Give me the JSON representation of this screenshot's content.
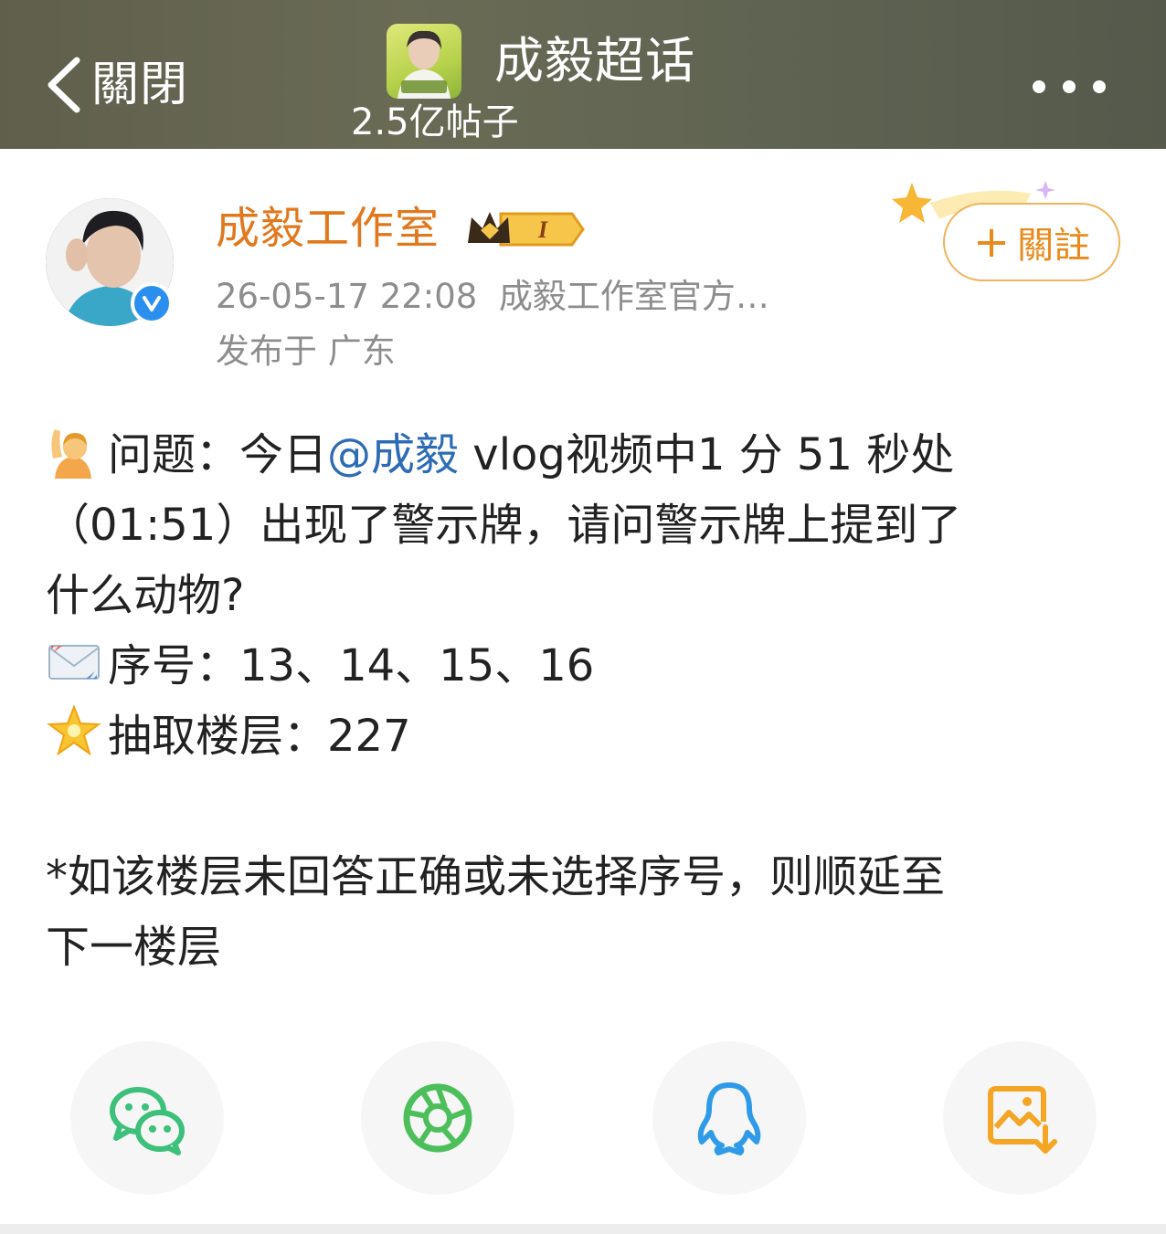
{
  "header": {
    "back_label": "關閉",
    "topic_title": "成毅超话",
    "topic_post_count": "2.5亿帖子"
  },
  "author": {
    "name": "成毅工作室",
    "post_time": "26-05-17 22:08",
    "source": "成毅工作室官方…",
    "location": "发布于 广东",
    "follow_label": "關註"
  },
  "post": {
    "line1_prefix": "问题：今日",
    "mention": "@成毅",
    "line1_suffix": " vlog视频中1 分 51 秒处",
    "line2": "（01:51）出现了警示牌，请问警示牌上提到了",
    "line3": "什么动物?",
    "line4": "序号：13、14、15、16",
    "line5": "抽取楼层：227",
    "line6": "*如该楼层未回答正确或未选择序号，则顺延至",
    "line7": "下一楼层"
  },
  "icons": {
    "back": "chevron-left-icon",
    "more": "more-dots-icon",
    "verified": "verified-check-icon",
    "vip": "crown-badge-icon",
    "emoji_question": "raising-hand-emoji",
    "emoji_number": "envelope-emoji",
    "emoji_floor": "star-emoji",
    "share": [
      "wechat-icon",
      "moments-icon",
      "qq-icon",
      "save-image-icon"
    ]
  },
  "colors": {
    "author_name": "#e2781d",
    "follow": "#e98a1a",
    "mention": "#2d6bb5",
    "wechat": "#3cc07a",
    "moments": "#4cbf5a",
    "qq": "#2f9be8",
    "save": "#f5a524"
  }
}
